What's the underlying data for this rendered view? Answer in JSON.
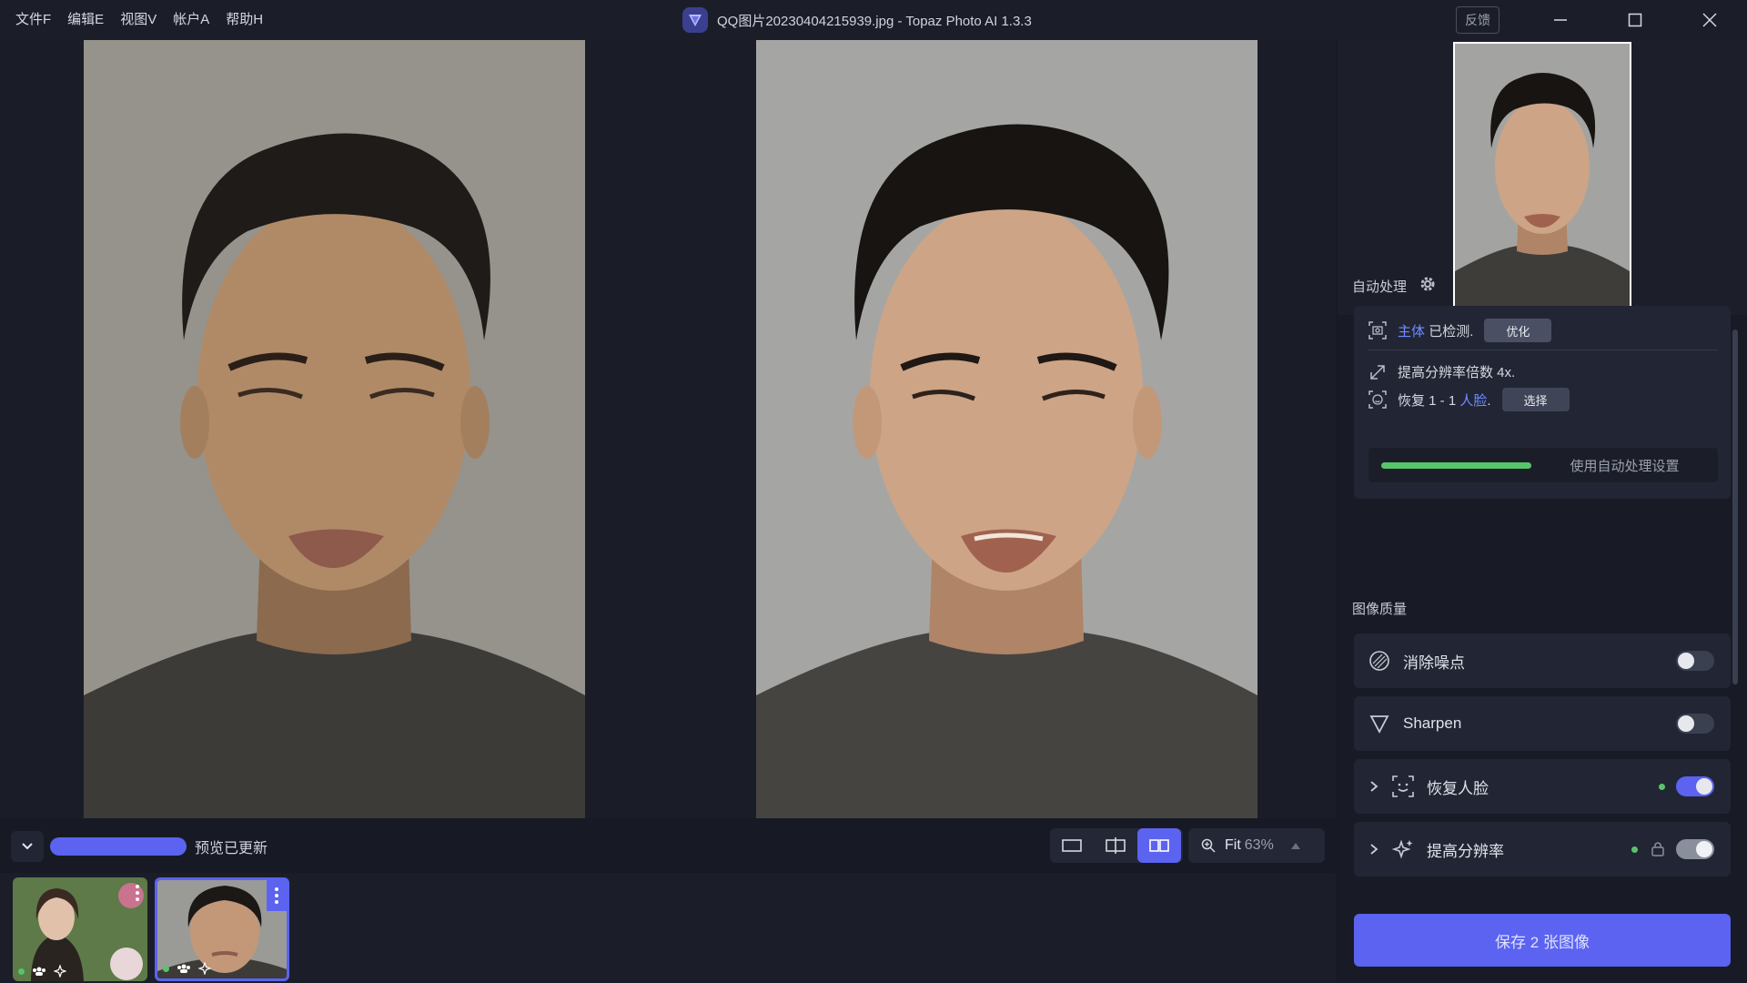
{
  "menu": [
    "文件F",
    "编辑E",
    "视图V",
    "帐户A",
    "帮助H"
  ],
  "window": {
    "title": "QQ图片20230404215939.jpg - Topaz Photo AI 1.3.3",
    "feedback_label": "反馈"
  },
  "viewer": {
    "status_text": "预览已更新",
    "zoom_fit": "Fit",
    "zoom_percent": "63%"
  },
  "panel": {
    "auto_section": "自动处理",
    "subject_link": "主体",
    "subject_text": "已检测.",
    "optimize_label": "优化",
    "upscale_text": "提高分辨率倍数 4x.",
    "restore_prefix": "恢复 1 - 1",
    "face_link": "人脸",
    "restore_suffix": ".",
    "select_label": "选择",
    "use_auto_label": "使用自动处理设置",
    "quality_section": "图像质量",
    "denoise_label": "消除噪点",
    "sharpen_label": "Sharpen",
    "recover_face_label": "恢复人脸",
    "upscale_label": "提高分辨率",
    "save_label": "保存 2 张图像"
  },
  "colors": {
    "accent": "#5b63f0",
    "link": "#6f8cff",
    "status_green": "#58c46a"
  }
}
